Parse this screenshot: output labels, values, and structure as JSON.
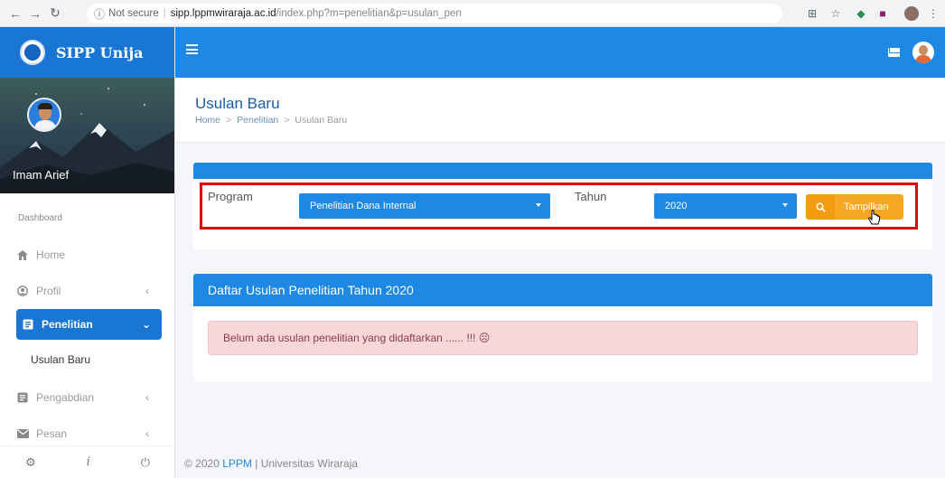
{
  "browser": {
    "not_secure": "Not secure",
    "url_host": "sipp.lppmwiraraja.ac.id",
    "url_path": "/index.php?m=penelitian&p=usulan_pen"
  },
  "app": {
    "name": "SIPP Unija"
  },
  "sidebar": {
    "user_name": "Imam Arief",
    "section": "Dashboard",
    "items": [
      {
        "label": "Home",
        "icon": "home-icon"
      },
      {
        "label": "Profil",
        "icon": "user-circle-icon"
      },
      {
        "label": "Penelitian",
        "icon": "document-icon"
      },
      {
        "label": "Pengabdian",
        "icon": "document-icon"
      },
      {
        "label": "Pesan",
        "icon": "mail-icon"
      }
    ],
    "sub_item": "Usulan Baru"
  },
  "page": {
    "title": "Usulan Baru",
    "breadcrumb": [
      "Home",
      "Penelitian",
      "Usulan Baru"
    ]
  },
  "filter": {
    "program_label": "Program",
    "program_value": "Penelitian Dana Internal",
    "tahun_label": "Tahun",
    "tahun_value": "2020",
    "button": "Tampilkan"
  },
  "list": {
    "title": "Daftar Usulan Penelitian Tahun 2020",
    "empty_message": "Belum ada usulan penelitian yang didaftarkan ...... !!! ☹"
  },
  "footer": {
    "prefix": "© 2020 ",
    "link": "LPPM",
    "suffix": " | Universitas Wiraraja"
  },
  "colors": {
    "primary": "#1e88e5",
    "warning": "#f6a623",
    "alert_bg": "#f8d7da",
    "highlight": "#e00000"
  }
}
